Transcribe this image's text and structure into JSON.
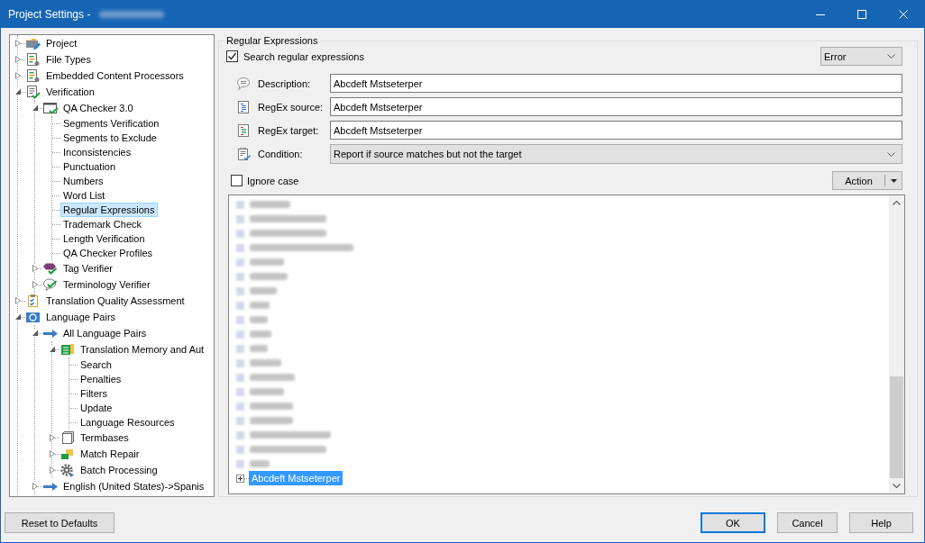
{
  "window": {
    "title": "Project Settings -",
    "title_redacted": true
  },
  "tree": {
    "items": [
      {
        "label": "Project",
        "kind": "project",
        "expanded": false,
        "selected": false
      },
      {
        "label": "File Types",
        "kind": "file-types",
        "expanded": false,
        "selected": false
      },
      {
        "label": "Embedded Content Processors",
        "kind": "file-types",
        "expanded": false,
        "selected": false
      },
      {
        "label": "Verification",
        "kind": "verification",
        "expanded": true,
        "selected": false,
        "children": [
          {
            "label": "QA Checker 3.0",
            "kind": "qa-checker",
            "expanded": true,
            "selected": false,
            "children": [
              {
                "label": "Segments Verification",
                "kind": "page",
                "selected": false
              },
              {
                "label": "Segments to Exclude",
                "kind": "page",
                "selected": false
              },
              {
                "label": "Inconsistencies",
                "kind": "page",
                "selected": false
              },
              {
                "label": "Punctuation",
                "kind": "page",
                "selected": false
              },
              {
                "label": "Numbers",
                "kind": "page",
                "selected": false
              },
              {
                "label": "Word List",
                "kind": "page",
                "selected": false
              },
              {
                "label": "Regular Expressions",
                "kind": "page",
                "selected": true
              },
              {
                "label": "Trademark Check",
                "kind": "page",
                "selected": false
              },
              {
                "label": "Length Verification",
                "kind": "page",
                "selected": false
              },
              {
                "label": "QA Checker Profiles",
                "kind": "page",
                "selected": false
              }
            ]
          },
          {
            "label": "Tag Verifier",
            "kind": "tag-verifier",
            "expanded": false,
            "selected": false
          },
          {
            "label": "Terminology Verifier",
            "kind": "terminology-verifier",
            "expanded": false,
            "selected": false
          }
        ]
      },
      {
        "label": "Translation Quality Assessment",
        "kind": "tqa",
        "expanded": false,
        "selected": false
      },
      {
        "label": "Language Pairs",
        "kind": "language-pairs",
        "expanded": true,
        "selected": false,
        "children": [
          {
            "label": "All Language Pairs",
            "kind": "arrow",
            "expanded": true,
            "selected": false,
            "children": [
              {
                "label": "Translation Memory and Aut",
                "kind": "tm",
                "expanded": true,
                "selected": false,
                "children": [
                  {
                    "label": "Search",
                    "kind": "page",
                    "selected": false
                  },
                  {
                    "label": "Penalties",
                    "kind": "page",
                    "selected": false
                  },
                  {
                    "label": "Filters",
                    "kind": "page",
                    "selected": false
                  },
                  {
                    "label": "Update",
                    "kind": "page",
                    "selected": false
                  },
                  {
                    "label": "Language Resources",
                    "kind": "page",
                    "selected": false
                  }
                ]
              },
              {
                "label": "Termbases",
                "kind": "termbase",
                "expanded": false,
                "selected": false
              },
              {
                "label": "Match Repair",
                "kind": "match-repair",
                "expanded": false,
                "selected": false
              },
              {
                "label": "Batch Processing",
                "kind": "batch",
                "expanded": false,
                "selected": false
              }
            ]
          },
          {
            "label": "English (United States)->Spanis",
            "kind": "arrow",
            "expanded": false,
            "selected": false
          }
        ]
      }
    ]
  },
  "regex_settings": {
    "title": "Regular Expressions",
    "search": {
      "label": "Search regular expressions",
      "checked": true
    },
    "severity": {
      "value": "Error"
    },
    "fields": [
      {
        "kind": "text",
        "label": "Description:",
        "value": "Abcdeft Mstseterper"
      },
      {
        "kind": "text",
        "label": "RegEx source:",
        "value": "Abcdeft Mstseterper"
      },
      {
        "kind": "text",
        "label": "RegEx target:",
        "value": "Abcdeft Mstseterper"
      },
      {
        "kind": "dropdown",
        "label": "Condition:",
        "value": "Report if source matches but not the target"
      }
    ],
    "ignore_case": {
      "label": "Ignore case",
      "checked": false
    },
    "action": {
      "label": "Action"
    },
    "rules": [
      {
        "kind": "redacted",
        "selected": false
      },
      {
        "kind": "redacted",
        "selected": false
      },
      {
        "kind": "redacted",
        "selected": false
      },
      {
        "kind": "redacted",
        "selected": false
      },
      {
        "kind": "redacted",
        "selected": false
      },
      {
        "kind": "redacted",
        "selected": false
      },
      {
        "kind": "redacted",
        "selected": false
      },
      {
        "kind": "redacted",
        "selected": false
      },
      {
        "kind": "redacted",
        "selected": false
      },
      {
        "kind": "redacted",
        "selected": false
      },
      {
        "kind": "redacted",
        "selected": false
      },
      {
        "kind": "redacted",
        "selected": false
      },
      {
        "kind": "redacted",
        "selected": false
      },
      {
        "kind": "redacted",
        "selected": false
      },
      {
        "kind": "redacted",
        "selected": false
      },
      {
        "kind": "redacted",
        "selected": false
      },
      {
        "kind": "redacted",
        "selected": false
      },
      {
        "kind": "redacted",
        "selected": false
      },
      {
        "kind": "redacted",
        "selected": false
      },
      {
        "kind": "rule",
        "label": "Abcdeft Mstseterper",
        "expanded": false,
        "selected": true
      }
    ]
  },
  "footer": {
    "reset": {
      "label": "Reset to Defaults"
    },
    "buttons": [
      {
        "label": "OK",
        "default": true
      },
      {
        "label": "Cancel",
        "default": false
      },
      {
        "label": "Help",
        "default": false
      }
    ]
  }
}
